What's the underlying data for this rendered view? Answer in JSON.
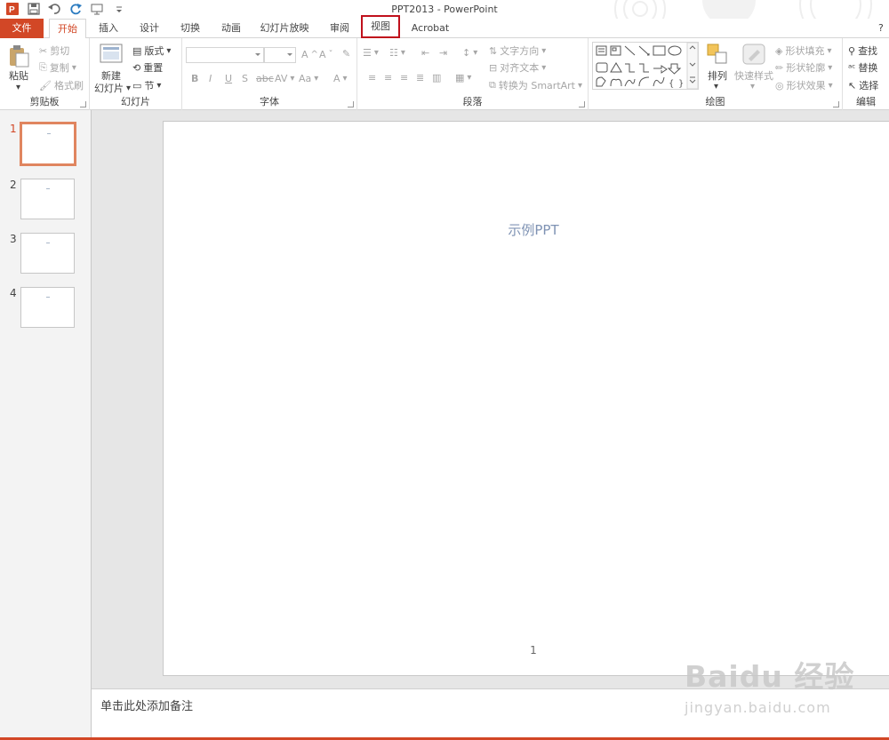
{
  "window": {
    "title": "PPT2013 - PowerPoint"
  },
  "quick_access": [
    "powerpoint-logo-icon",
    "save-icon",
    "undo-icon",
    "redo-icon",
    "present-icon",
    "customize-icon"
  ],
  "tabs": [
    {
      "label": "文件",
      "type": "file"
    },
    {
      "label": "开始",
      "type": "active"
    },
    {
      "label": "插入"
    },
    {
      "label": "设计"
    },
    {
      "label": "切换"
    },
    {
      "label": "动画"
    },
    {
      "label": "幻灯片放映"
    },
    {
      "label": "审阅"
    },
    {
      "label": "视图",
      "type": "highlight"
    },
    {
      "label": "Acrobat"
    }
  ],
  "ribbon": {
    "clipboard": {
      "label": "剪贴板",
      "paste": "粘贴",
      "cut": "剪切",
      "copy": "复制",
      "format_painter": "格式刷"
    },
    "slides": {
      "label": "幻灯片",
      "new_slide_1": "新建",
      "new_slide_2": "幻灯片",
      "layout": "版式",
      "reset": "重置",
      "section": "节"
    },
    "font": {
      "label": "字体",
      "bold": "B",
      "italic": "I",
      "underline": "U",
      "shadow": "S",
      "strike": "abc",
      "spacing": "AV",
      "case": "Aa",
      "color": "A"
    },
    "paragraph": {
      "label": "段落",
      "text_direction": "文字方向",
      "align_text": "对齐文本",
      "smartart": "转换为 SmartArt"
    },
    "drawing": {
      "label": "绘图",
      "arrange": "排列",
      "quick_styles": "快速样式",
      "shape_fill": "形状填充",
      "shape_outline": "形状轮廓",
      "shape_effects": "形状效果"
    },
    "editing": {
      "label": "编辑",
      "find": "查找",
      "replace": "替换",
      "select": "选择"
    }
  },
  "thumbnails": [
    {
      "num": "1",
      "selected": true
    },
    {
      "num": "2",
      "selected": false
    },
    {
      "num": "3",
      "selected": false
    },
    {
      "num": "4",
      "selected": false
    }
  ],
  "slide": {
    "title": "示例PPT",
    "page_number": "1"
  },
  "notes": {
    "placeholder": "单击此处添加备注"
  },
  "watermark": {
    "logo": "Baidu 经验",
    "url": "jingyan.baidu.com"
  },
  "colors": {
    "accent": "#d24726",
    "highlight_box": "#c0101c",
    "title_text": "#7f93b4"
  }
}
